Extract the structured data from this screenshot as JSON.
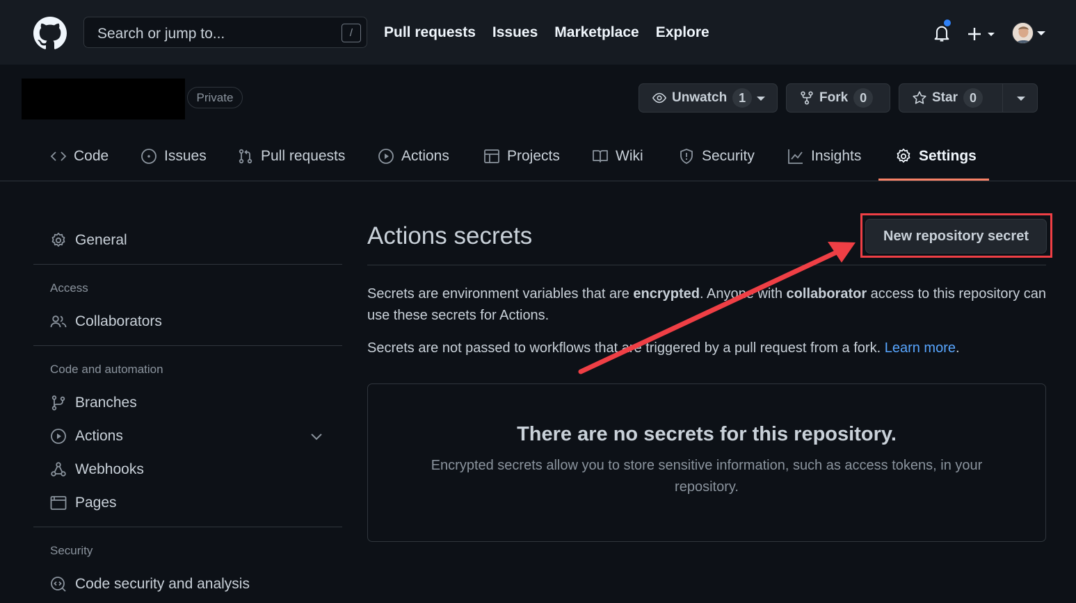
{
  "header": {
    "search_placeholder": "Search or jump to...",
    "search_shortcut": "/",
    "nav": [
      "Pull requests",
      "Issues",
      "Marketplace",
      "Explore"
    ]
  },
  "repo": {
    "visibility": "Private",
    "unwatch_label": "Unwatch",
    "watch_count": "1",
    "fork_label": "Fork",
    "fork_count": "0",
    "star_label": "Star",
    "star_count": "0"
  },
  "tabs": [
    {
      "label": "Code",
      "icon": "code-icon"
    },
    {
      "label": "Issues",
      "icon": "issue-opened-icon"
    },
    {
      "label": "Pull requests",
      "icon": "git-pull-request-icon"
    },
    {
      "label": "Actions",
      "icon": "play-icon"
    },
    {
      "label": "Projects",
      "icon": "table-icon"
    },
    {
      "label": "Wiki",
      "icon": "book-icon"
    },
    {
      "label": "Security",
      "icon": "shield-icon"
    },
    {
      "label": "Insights",
      "icon": "graph-icon"
    },
    {
      "label": "Settings",
      "icon": "gear-icon",
      "active": true
    }
  ],
  "sidebar": {
    "general": "General",
    "access_heading": "Access",
    "collaborators": "Collaborators",
    "code_automation_heading": "Code and automation",
    "branches": "Branches",
    "actions": "Actions",
    "webhooks": "Webhooks",
    "pages": "Pages",
    "security_heading": "Security",
    "code_security": "Code security and analysis"
  },
  "main": {
    "title": "Actions secrets",
    "new_secret_button": "New repository secret",
    "para1_a": "Secrets are environment variables that are ",
    "para1_b": "encrypted",
    "para1_c": ". Anyone with ",
    "para1_d": "collaborator",
    "para1_e": " access to this repository can use these secrets for Actions.",
    "para2_a": "Secrets are not passed to workflows that are triggered by a pull request from a fork. ",
    "para2_link": "Learn more",
    "para2_end": ".",
    "empty_title": "There are no secrets for this repository.",
    "empty_desc": "Encrypted secrets allow you to store sensitive information, such as access tokens, in your repository."
  },
  "colors": {
    "background": "#0d1117",
    "header": "#161b22",
    "active_tab_underline": "#f78166",
    "link": "#58a6ff",
    "annotation": "#ef3f45"
  }
}
